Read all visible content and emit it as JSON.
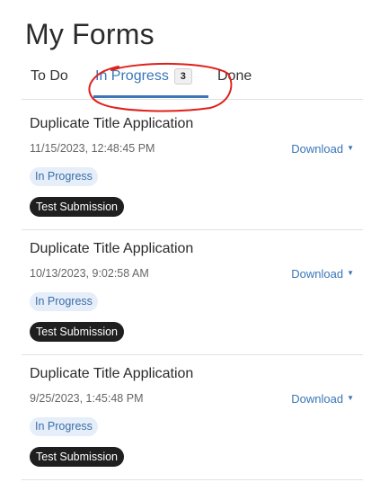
{
  "page": {
    "title": "My Forms"
  },
  "tabs": [
    {
      "label": "To Do"
    },
    {
      "label": "In Progress",
      "count": "3",
      "active": true
    },
    {
      "label": "Done"
    }
  ],
  "annotation": {
    "color": "#e0201b",
    "shape": "hand-drawn red circle around In Progress tab"
  },
  "colors": {
    "accent": "#3a76b8",
    "status_pill_bg": "#e6eef9",
    "badge_bg": "#1f1f1f"
  },
  "forms": [
    {
      "title": "Duplicate Title Application",
      "date": "11/15/2023, 12:48:45 PM",
      "download_label": "Download",
      "status": "In Progress",
      "badge": "Test Submission"
    },
    {
      "title": "Duplicate Title Application",
      "date": "10/13/2023, 9:02:58 AM",
      "download_label": "Download",
      "status": "In Progress",
      "badge": "Test Submission"
    },
    {
      "title": "Duplicate Title Application",
      "date": "9/25/2023, 1:45:48 PM",
      "download_label": "Download",
      "status": "In Progress",
      "badge": "Test Submission"
    }
  ]
}
